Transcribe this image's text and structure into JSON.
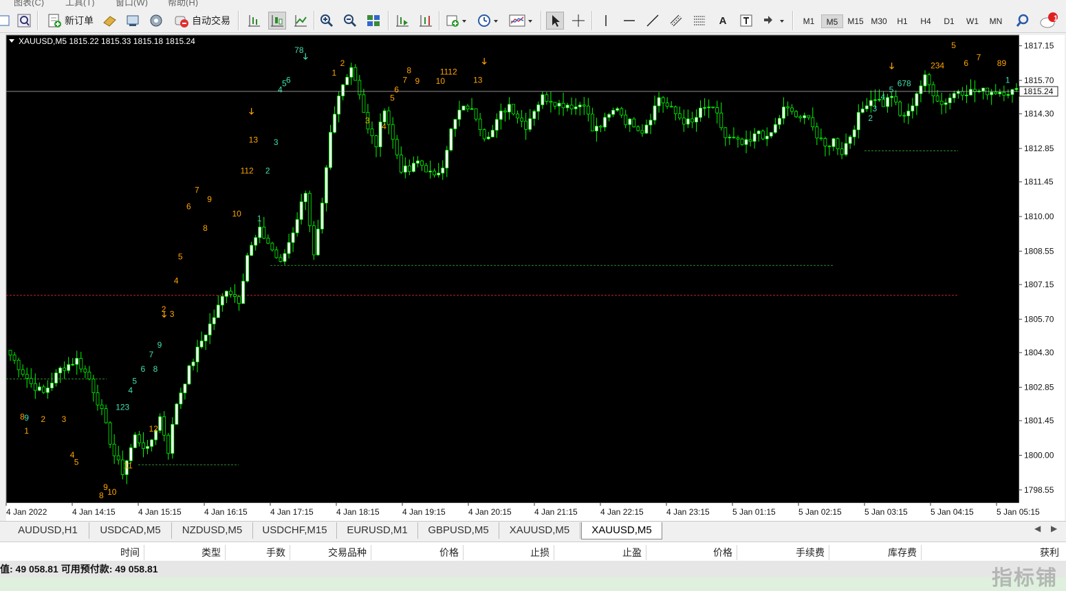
{
  "menu": [
    "图表(C)",
    "工具(T)",
    "窗口(W)",
    "帮助(H)"
  ],
  "toolbar": {
    "new_order_label": "新订单",
    "auto_trading_label": "自动交易",
    "notification_count": "1",
    "timeframes": [
      "M1",
      "M5",
      "M15",
      "M30",
      "H1",
      "H4",
      "D1",
      "W1",
      "MN"
    ],
    "active_timeframe": "M5"
  },
  "chart": {
    "header": "XAUUSD,M5  1815.22 1815.33 1815.18 1815.24",
    "current_price_label": "1815.24",
    "colors": {
      "background": "#000000",
      "bull_body": "#ffffff",
      "wick": "#00ff00",
      "grid": "#444444",
      "price_line": "#c0c0c0",
      "support_green": "#2e8b2e",
      "support_red": "#cc2222",
      "count_buy": "#ffa500",
      "count_sell": "#40e0b0"
    }
  },
  "chart_data": {
    "type": "candlestick",
    "symbol": "XAUUSD",
    "timeframe": "M5",
    "ylim": [
      1798.0,
      1817.6
    ],
    "yticks": [
      "1817.15",
      "1815.70",
      "1814.30",
      "1812.85",
      "1811.45",
      "1810.00",
      "1808.55",
      "1807.15",
      "1805.70",
      "1804.30",
      "1802.85",
      "1801.45",
      "1800.00",
      "1798.55"
    ],
    "xticks": [
      "4 Jan 2022",
      "4 Jan 14:15",
      "4 Jan 15:15",
      "4 Jan 16:15",
      "4 Jan 17:15",
      "4 Jan 18:15",
      "4 Jan 19:15",
      "4 Jan 20:15",
      "4 Jan 21:15",
      "4 Jan 22:15",
      "4 Jan 23:15",
      "5 Jan 01:15",
      "5 Jan 02:15",
      "5 Jan 03:15",
      "5 Jan 04:15",
      "5 Jan 05:15"
    ],
    "current_price": 1815.24,
    "horizontal_levels": [
      {
        "price": 1803.2,
        "color": "#2e8b2e",
        "from": "4 Jan 2022",
        "to": "4 Jan 14:15"
      },
      {
        "price": 1799.6,
        "color": "#2e8b2e",
        "from": "4 Jan 15:15",
        "to": "4 Jan 16:15"
      },
      {
        "price": 1807.95,
        "color": "#2e8b2e",
        "from": "4 Jan 17:15",
        "to": "5 Jan 02:15"
      },
      {
        "price": 1812.75,
        "color": "#2e8b2e",
        "from": "5 Jan 03:15",
        "to": "5 Jan 04:15"
      },
      {
        "price": 1806.7,
        "color": "#cc2222",
        "from": "4 Jan 2022",
        "to": "5 Jan 04:15"
      }
    ],
    "close_path": [
      [
        0,
        1804.2
      ],
      [
        5,
        1803.0
      ],
      [
        8,
        1802.6
      ],
      [
        12,
        1803.6
      ],
      [
        16,
        1804.0
      ],
      [
        19,
        1803.2
      ],
      [
        22,
        1801.8
      ],
      [
        25,
        1800.0
      ],
      [
        27,
        1799.3
      ],
      [
        30,
        1800.8
      ],
      [
        33,
        1800.2
      ],
      [
        36,
        1801.6
      ],
      [
        38,
        1800.2
      ],
      [
        40,
        1802.2
      ],
      [
        43,
        1803.6
      ],
      [
        46,
        1804.8
      ],
      [
        49,
        1805.8
      ],
      [
        52,
        1807.0
      ],
      [
        55,
        1806.5
      ],
      [
        57,
        1808.4
      ],
      [
        60,
        1809.4
      ],
      [
        62,
        1808.9
      ],
      [
        65,
        1808.0
      ],
      [
        68,
        1809.4
      ],
      [
        71,
        1811.1
      ],
      [
        73,
        1808.3
      ],
      [
        75,
        1810.4
      ],
      [
        77,
        1813.4
      ],
      [
        79,
        1815.0
      ],
      [
        81,
        1816.0
      ],
      [
        82,
        1816.3
      ],
      [
        84,
        1815.2
      ],
      [
        86,
        1813.6
      ],
      [
        88,
        1813.0
      ],
      [
        90,
        1814.6
      ],
      [
        92,
        1813.2
      ],
      [
        94,
        1812.0
      ],
      [
        96,
        1811.9
      ],
      [
        98,
        1812.3
      ],
      [
        100,
        1812.0
      ],
      [
        102,
        1811.6
      ],
      [
        104,
        1812.2
      ],
      [
        106,
        1813.6
      ],
      [
        108,
        1814.4
      ],
      [
        110,
        1814.6
      ],
      [
        112,
        1814.2
      ],
      [
        114,
        1813.4
      ],
      [
        116,
        1813.6
      ],
      [
        118,
        1814.3
      ],
      [
        120,
        1814.7
      ],
      [
        122,
        1814.2
      ],
      [
        124,
        1813.8
      ],
      [
        126,
        1814.5
      ],
      [
        128,
        1815.0
      ],
      [
        130,
        1814.9
      ],
      [
        132,
        1814.7
      ],
      [
        134,
        1814.7
      ],
      [
        136,
        1814.6
      ],
      [
        138,
        1814.8
      ],
      [
        140,
        1813.6
      ],
      [
        142,
        1813.8
      ],
      [
        144,
        1814.2
      ],
      [
        146,
        1814.6
      ],
      [
        148,
        1814.0
      ],
      [
        150,
        1813.9
      ],
      [
        152,
        1813.6
      ],
      [
        154,
        1814.2
      ],
      [
        156,
        1815.0
      ],
      [
        158,
        1814.6
      ],
      [
        160,
        1814.3
      ],
      [
        162,
        1814.0
      ],
      [
        164,
        1813.9
      ],
      [
        166,
        1814.4
      ],
      [
        168,
        1814.6
      ],
      [
        170,
        1814.2
      ],
      [
        172,
        1813.3
      ],
      [
        174,
        1813.2
      ],
      [
        176,
        1813.0
      ],
      [
        178,
        1813.1
      ],
      [
        180,
        1813.6
      ],
      [
        182,
        1813.2
      ],
      [
        184,
        1813.8
      ],
      [
        186,
        1814.5
      ],
      [
        188,
        1814.4
      ],
      [
        190,
        1814.0
      ],
      [
        192,
        1814.3
      ],
      [
        194,
        1813.3
      ],
      [
        196,
        1812.9
      ],
      [
        198,
        1813.2
      ],
      [
        200,
        1812.7
      ],
      [
        202,
        1813.4
      ],
      [
        204,
        1814.2
      ],
      [
        206,
        1814.8
      ],
      [
        208,
        1815.0
      ],
      [
        210,
        1814.7
      ],
      [
        212,
        1815.1
      ],
      [
        214,
        1814.2
      ],
      [
        216,
        1814.3
      ],
      [
        218,
        1815.2
      ],
      [
        220,
        1815.8
      ],
      [
        222,
        1815.2
      ],
      [
        224,
        1814.7
      ],
      [
        226,
        1815.0
      ],
      [
        228,
        1815.3
      ],
      [
        229,
        1815.24
      ]
    ],
    "count_labels": [
      {
        "i": 3,
        "p": 1801.5,
        "t": "8",
        "c": "#ffa500"
      },
      {
        "i": 4,
        "p": 1801.45,
        "t": "9",
        "c": "#40e0b0"
      },
      {
        "i": 4,
        "p": 1800.9,
        "t": "1",
        "c": "#ffa500"
      },
      {
        "i": 8,
        "p": 1801.4,
        "t": "2",
        "c": "#ffa500"
      },
      {
        "i": 13,
        "p": 1801.4,
        "t": "3",
        "c": "#ffa500"
      },
      {
        "i": 15,
        "p": 1799.9,
        "t": "4",
        "c": "#ffa500"
      },
      {
        "i": 16,
        "p": 1799.6,
        "t": "5",
        "c": "#ffa500"
      },
      {
        "i": 22,
        "p": 1798.2,
        "t": "8",
        "c": "#ffa500"
      },
      {
        "i": 23,
        "p": 1798.55,
        "t": "9",
        "c": "#ffa500"
      },
      {
        "i": 24,
        "p": 1798.35,
        "t": "10",
        "c": "#ffa500"
      },
      {
        "i": 28,
        "p": 1799.45,
        "t": "11",
        "c": "#ffa500"
      },
      {
        "i": 34,
        "p": 1801.0,
        "t": "12",
        "c": "#ffa500"
      },
      {
        "i": 26,
        "p": 1801.9,
        "t": "123",
        "c": "#40e0b0"
      },
      {
        "i": 29,
        "p": 1802.6,
        "t": "4",
        "c": "#40e0b0"
      },
      {
        "i": 30,
        "p": 1803.0,
        "t": "5",
        "c": "#40e0b0"
      },
      {
        "i": 32,
        "p": 1803.5,
        "t": "6",
        "c": "#40e0b0"
      },
      {
        "i": 34,
        "p": 1804.1,
        "t": "7",
        "c": "#40e0b0"
      },
      {
        "i": 35,
        "p": 1803.5,
        "t": "8",
        "c": "#40e0b0"
      },
      {
        "i": 36,
        "p": 1804.5,
        "t": "9",
        "c": "#40e0b0"
      },
      {
        "i": 37,
        "p": 1806.0,
        "t": "2",
        "c": "#ffa500"
      },
      {
        "i": 39,
        "p": 1805.8,
        "t": "3",
        "c": "#ffa500"
      },
      {
        "i": 40,
        "p": 1807.2,
        "t": "4",
        "c": "#ffa500"
      },
      {
        "i": 41,
        "p": 1808.2,
        "t": "5",
        "c": "#ffa500"
      },
      {
        "i": 43,
        "p": 1810.3,
        "t": "6",
        "c": "#ffa500"
      },
      {
        "i": 45,
        "p": 1811.0,
        "t": "7",
        "c": "#ffa500"
      },
      {
        "i": 47,
        "p": 1809.4,
        "t": "8",
        "c": "#ffa500"
      },
      {
        "i": 48,
        "p": 1810.6,
        "t": "9",
        "c": "#ffa500"
      },
      {
        "i": 54,
        "p": 1810.0,
        "t": "10",
        "c": "#ffa500"
      },
      {
        "i": 56,
        "p": 1811.8,
        "t": "112",
        "c": "#ffa500"
      },
      {
        "i": 58,
        "p": 1813.1,
        "t": "13",
        "c": "#ffa500"
      },
      {
        "i": 60,
        "p": 1809.8,
        "t": "1",
        "c": "#40e0b0"
      },
      {
        "i": 62,
        "p": 1811.8,
        "t": "2",
        "c": "#40e0b0"
      },
      {
        "i": 64,
        "p": 1813.0,
        "t": "3",
        "c": "#40e0b0"
      },
      {
        "i": 65,
        "p": 1815.2,
        "t": "4",
        "c": "#40e0b0"
      },
      {
        "i": 66,
        "p": 1815.45,
        "t": "5",
        "c": "#40e0b0"
      },
      {
        "i": 67,
        "p": 1815.6,
        "t": "6",
        "c": "#40e0b0"
      },
      {
        "i": 69,
        "p": 1816.85,
        "t": "78",
        "c": "#40e0b0"
      },
      {
        "i": 78,
        "p": 1815.9,
        "t": "1",
        "c": "#ffa500"
      },
      {
        "i": 80,
        "p": 1816.3,
        "t": "2",
        "c": "#ffa500"
      },
      {
        "i": 86,
        "p": 1813.9,
        "t": "3",
        "c": "#ffa500"
      },
      {
        "i": 90,
        "p": 1813.65,
        "t": "4",
        "c": "#ffa500"
      },
      {
        "i": 92,
        "p": 1814.85,
        "t": "5",
        "c": "#ffa500"
      },
      {
        "i": 93,
        "p": 1815.2,
        "t": "6",
        "c": "#ffa500"
      },
      {
        "i": 95,
        "p": 1815.6,
        "t": "7",
        "c": "#ffa500"
      },
      {
        "i": 96,
        "p": 1816.0,
        "t": "8",
        "c": "#ffa500"
      },
      {
        "i": 98,
        "p": 1815.55,
        "t": "9",
        "c": "#ffa500"
      },
      {
        "i": 103,
        "p": 1815.55,
        "t": "10",
        "c": "#ffa500"
      },
      {
        "i": 104,
        "p": 1815.95,
        "t": "1112",
        "c": "#ffa500"
      },
      {
        "i": 112,
        "p": 1815.6,
        "t": "13",
        "c": "#ffa500"
      },
      {
        "i": 207,
        "p": 1814.0,
        "t": "2",
        "c": "#40e0b0"
      },
      {
        "i": 208,
        "p": 1814.4,
        "t": "3",
        "c": "#40e0b0"
      },
      {
        "i": 210,
        "p": 1814.9,
        "t": "4",
        "c": "#40e0b0"
      },
      {
        "i": 212,
        "p": 1815.2,
        "t": "5",
        "c": "#40e0b0"
      },
      {
        "i": 214,
        "p": 1815.45,
        "t": "678",
        "c": "#40e0b0"
      },
      {
        "i": 222,
        "p": 1816.2,
        "t": "234",
        "c": "#ffa500"
      },
      {
        "i": 227,
        "p": 1817.05,
        "t": "5",
        "c": "#ffa500"
      },
      {
        "i": 230,
        "p": 1816.3,
        "t": "6",
        "c": "#ffa500"
      },
      {
        "i": 233,
        "p": 1816.55,
        "t": "7",
        "c": "#ffa500"
      },
      {
        "i": 238,
        "p": 1816.3,
        "t": "89",
        "c": "#ffa500"
      },
      {
        "i": 240,
        "p": 1815.6,
        "t": "1",
        "c": "#40e0b0"
      }
    ],
    "arrows": [
      {
        "i": 71,
        "p": 1816.7,
        "c": "#40e0b0"
      },
      {
        "i": 58,
        "p": 1814.4,
        "c": "#ffa500"
      },
      {
        "i": 114,
        "p": 1816.5,
        "c": "#ffa500"
      },
      {
        "i": 37,
        "p": 1805.9,
        "c": "#ffa500"
      },
      {
        "i": 212,
        "p": 1816.3,
        "c": "#ffa500"
      }
    ]
  },
  "tabs": [
    "AUDUSD,H1",
    "USDCAD,M5",
    "NZDUSD,M5",
    "USDCHF,M15",
    "EURUSD,M1",
    "GBPUSD,M5",
    "XAUUSD,M5",
    "XAUUSD,M5"
  ],
  "active_tab_index": 7,
  "terminal": {
    "columns": [
      "时间",
      "类型",
      "手数",
      "交易品种",
      "价格",
      "止损",
      "止盈",
      "价格",
      "手续费",
      "库存费",
      "获利"
    ],
    "summary": "值: 49 058.81  可用预付款: 49 058.81"
  },
  "watermark": "指标铺"
}
